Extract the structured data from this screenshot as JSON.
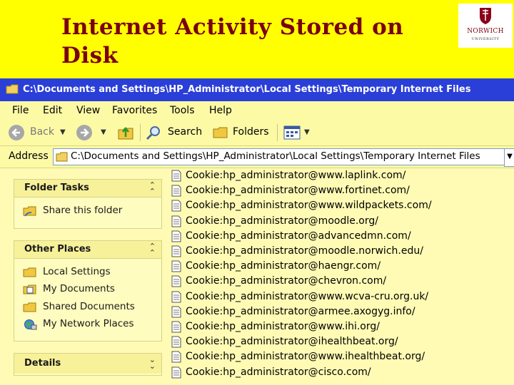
{
  "slide": {
    "title": "Internet Activity Stored on Disk"
  },
  "logo": {
    "name": "NORWICH",
    "sub": "UNIVERSITY"
  },
  "window": {
    "title": "C:\\Documents and Settings\\HP_Administrator\\Local Settings\\Temporary Internet Files",
    "menu": [
      "File",
      "Edit",
      "View",
      "Favorites",
      "Tools",
      "Help"
    ],
    "toolbar": {
      "back": "Back",
      "search": "Search",
      "folders": "Folders"
    },
    "address": {
      "label": "Address",
      "value": "C:\\Documents and Settings\\HP_Administrator\\Local Settings\\Temporary Internet Files"
    }
  },
  "panels": {
    "folder_tasks": {
      "title": "Folder Tasks",
      "items": [
        "Share this folder"
      ]
    },
    "other_places": {
      "title": "Other Places",
      "items": [
        "Local Settings",
        "My Documents",
        "Shared Documents",
        "My Network Places"
      ]
    },
    "details": {
      "title": "Details"
    }
  },
  "files": [
    "Cookie:hp_administrator@www.laplink.com/",
    "Cookie:hp_administrator@www.fortinet.com/",
    "Cookie:hp_administrator@www.wildpackets.com/",
    "Cookie:hp_administrator@moodle.org/",
    "Cookie:hp_administrator@advancedmn.com/",
    "Cookie:hp_administrator@moodle.norwich.edu/",
    "Cookie:hp_administrator@haengr.com/",
    "Cookie:hp_administrator@chevron.com/",
    "Cookie:hp_administrator@www.wcva-cru.org.uk/",
    "Cookie:hp_administrator@armee.axogyg.info/",
    "Cookie:hp_administrator@www.ihi.org/",
    "Cookie:hp_administrator@ihealthbeat.org/",
    "Cookie:hp_administrator@www.ihealthbeat.org/",
    "Cookie:hp_administrator@cisco.com/"
  ],
  "colors": {
    "slide_bg": "#ffff00",
    "title": "#7a0010",
    "titlebar": "#2a3ed8",
    "explorer_bg": "#fffab0"
  }
}
